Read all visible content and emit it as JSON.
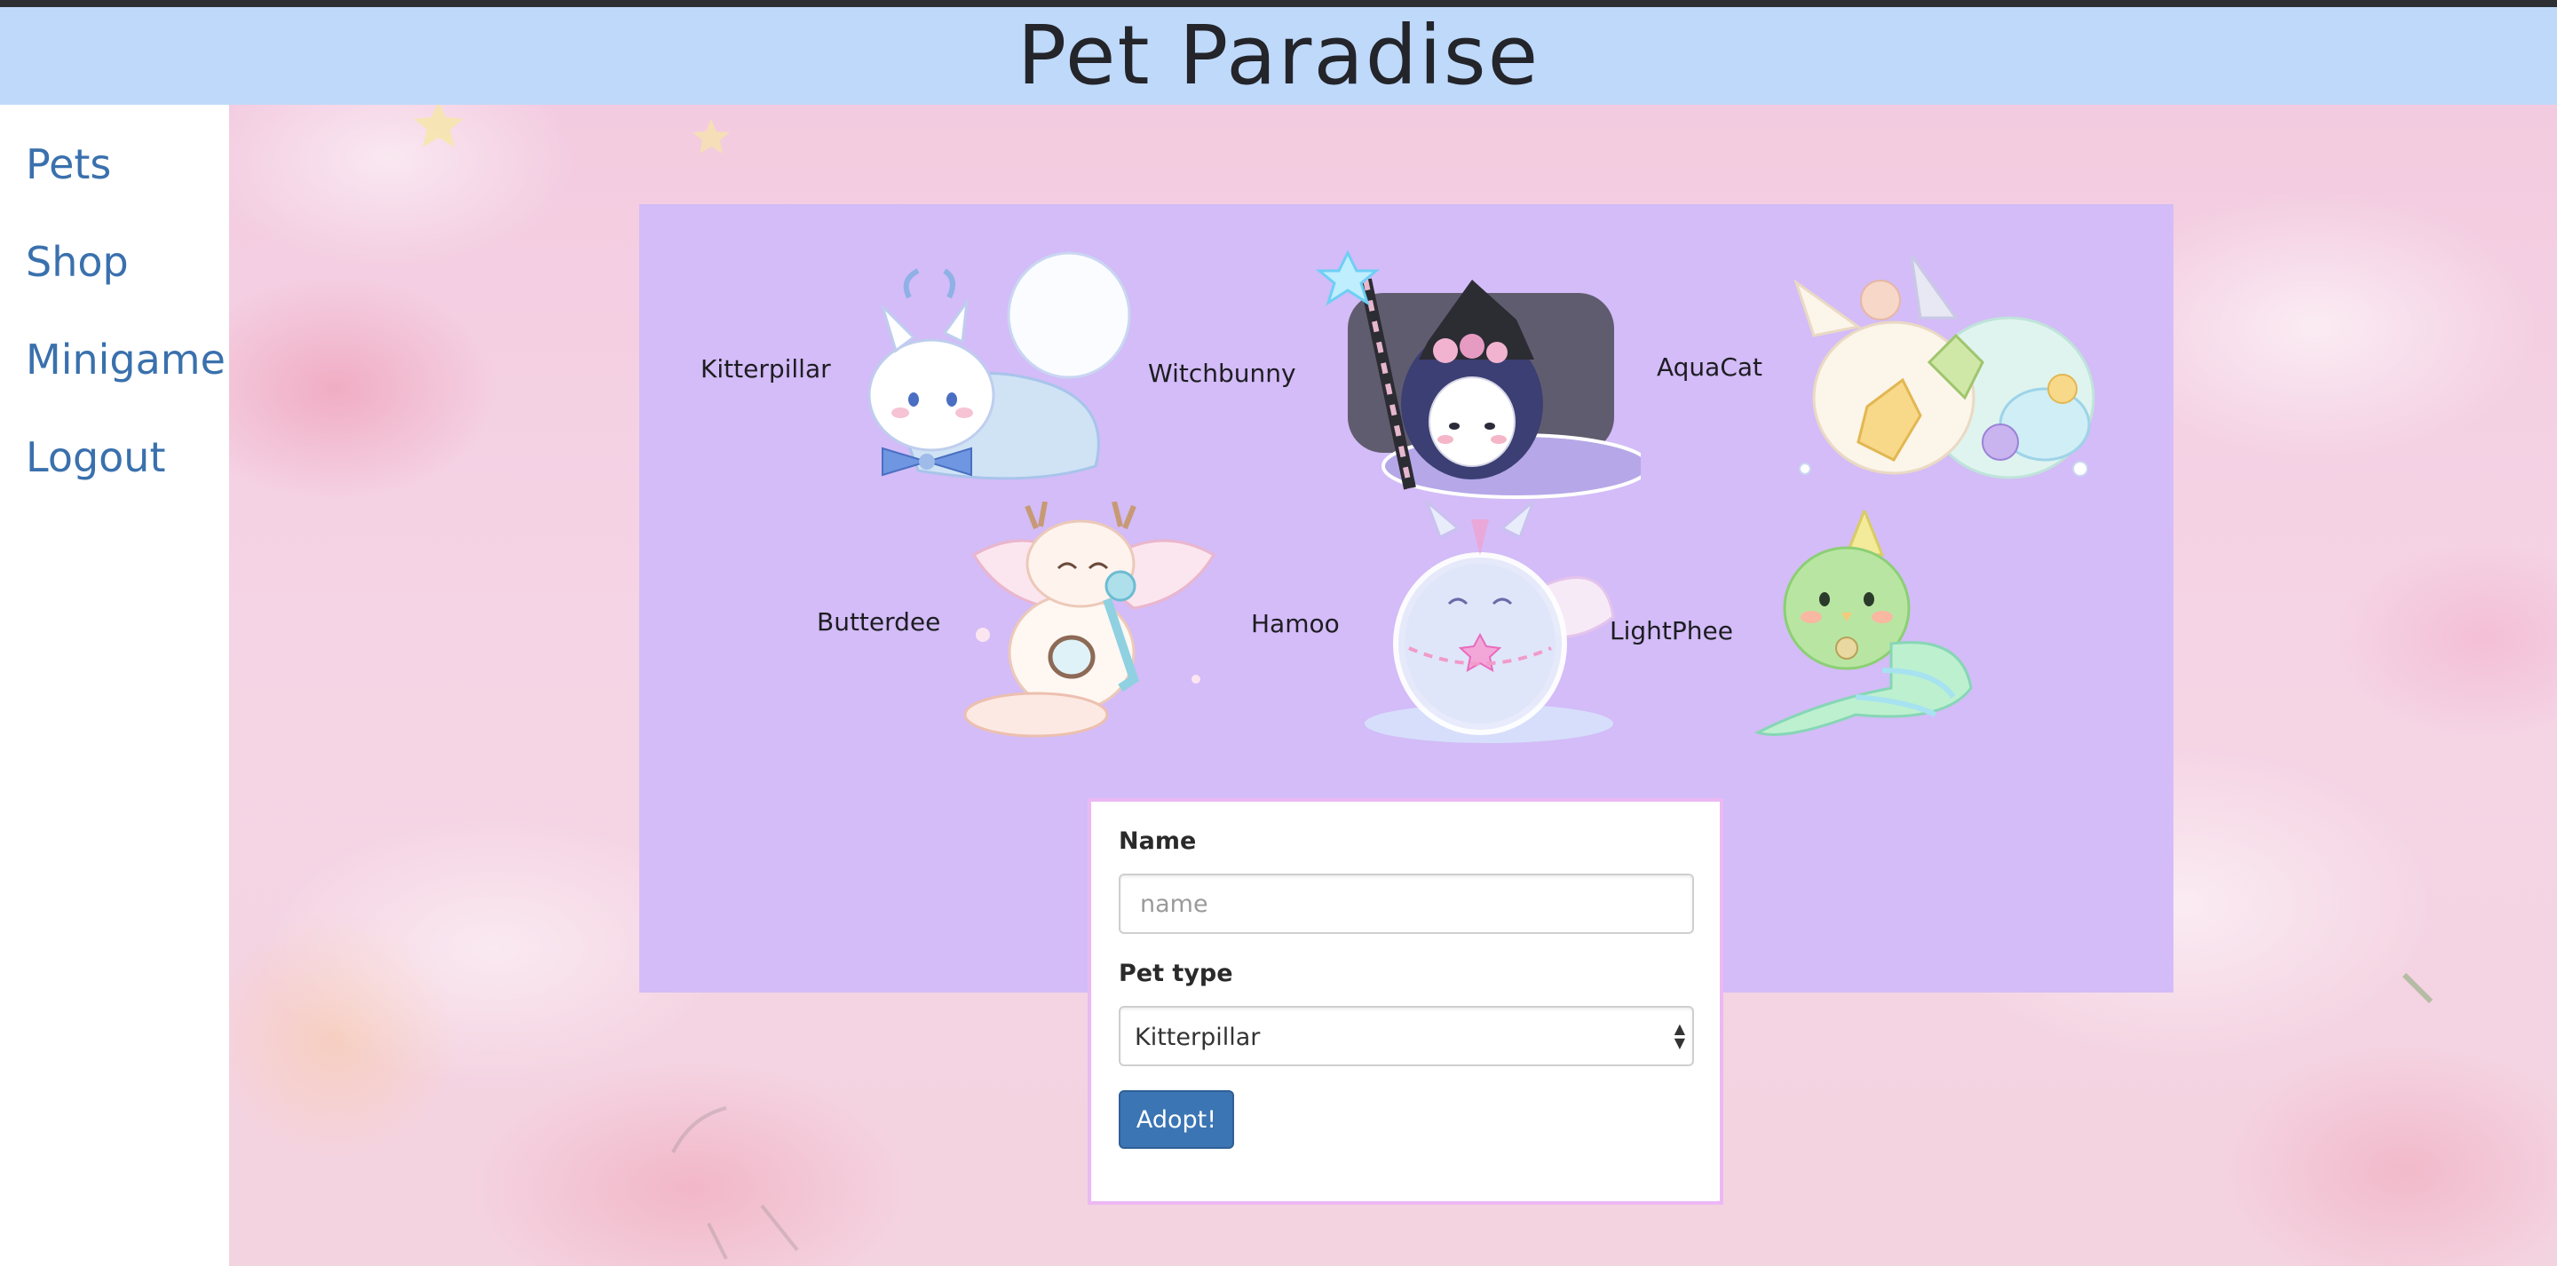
{
  "header": {
    "title": "Pet Paradise"
  },
  "sidebar": {
    "items": [
      {
        "label": "Pets"
      },
      {
        "label": "Shop"
      },
      {
        "label": "Minigame"
      },
      {
        "label": "Logout"
      }
    ]
  },
  "pets": [
    {
      "name": "Kitterpillar",
      "icon": "white-cat-caterpillar-icon"
    },
    {
      "name": "Witchbunny",
      "icon": "witch-bunny-icon"
    },
    {
      "name": "AquaCat",
      "icon": "aqua-cat-icon"
    },
    {
      "name": "Butterdee",
      "icon": "butterfly-deer-icon"
    },
    {
      "name": "Hamoo",
      "icon": "hamster-unicorn-icon"
    },
    {
      "name": "LightPhee",
      "icon": "green-bird-icon"
    }
  ],
  "form": {
    "name_label": "Name",
    "name_placeholder": "name",
    "name_value": "",
    "type_label": "Pet type",
    "type_selected": "Kitterpillar",
    "submit_label": "Adopt!"
  },
  "colors": {
    "header_bg": "#bfd9fb",
    "panel_bg": "#d3bcf7",
    "link": "#3a70ad",
    "button": "#3b75b3",
    "form_border": "#ecb8f4"
  }
}
